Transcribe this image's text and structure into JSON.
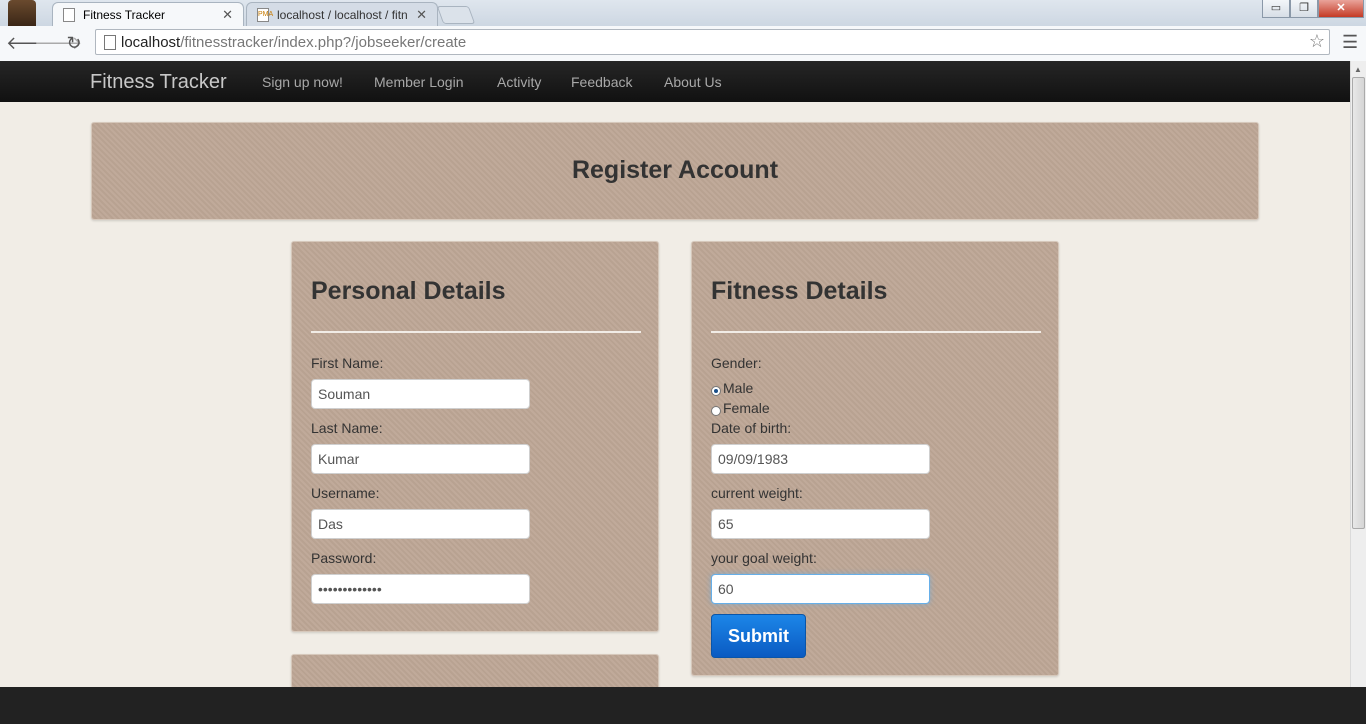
{
  "browser": {
    "tabs": [
      {
        "title": "Fitness Tracker",
        "active": true
      },
      {
        "title": "localhost / localhost / fitn",
        "active": false,
        "icon_text": "PMA"
      }
    ],
    "url_host": "localhost",
    "url_path": "/fitnesstracker/index.php?/jobseeker/create",
    "window_controls": {
      "minimize": "▭",
      "restore": "❐",
      "close": "✕"
    }
  },
  "navbar": {
    "brand": "Fitness Tracker",
    "links": [
      "Sign up now!",
      "Member Login",
      "Activity",
      "Feedback",
      "About Us"
    ]
  },
  "hero": {
    "title": "Register Account"
  },
  "personal": {
    "heading": "Personal Details",
    "first_name_label": "First Name:",
    "first_name_value": "Souman",
    "last_name_label": "Last Name:",
    "last_name_value": "Kumar",
    "username_label": "Username:",
    "username_value": "Das",
    "password_label": "Password:",
    "password_value": "•••••••••••••"
  },
  "fitness": {
    "heading": "Fitness Details",
    "gender_label": "Gender:",
    "gender_options": [
      "Male",
      "Female"
    ],
    "gender_selected": "Male",
    "dob_label": "Date of birth:",
    "dob_value": "09/09/1983",
    "current_weight_label": "current weight:",
    "current_weight_value": "65",
    "goal_weight_label": "your goal weight:",
    "goal_weight_value": "60",
    "submit_label": "Submit"
  },
  "colors": {
    "panel": "#bea796",
    "navbar": "#1a1a1a",
    "submit": "#0a6cd6",
    "page_bg": "#f1ede6"
  }
}
